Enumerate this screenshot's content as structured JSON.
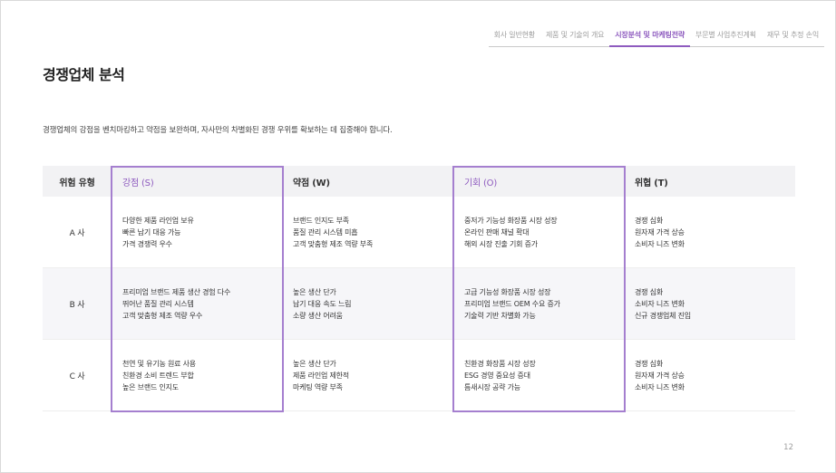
{
  "nav": {
    "tabs": [
      {
        "label": "회사 일반현황",
        "active": false
      },
      {
        "label": "제품 및 기술의 개요",
        "active": false
      },
      {
        "label": "시장분석 및 마케팅전략",
        "active": true
      },
      {
        "label": "부문별 사업추진계획",
        "active": false
      },
      {
        "label": "재무 및 추정 손익",
        "active": false
      }
    ],
    "accent_color": "#8e5bbf"
  },
  "page": {
    "title": "경쟁업체 분석",
    "description": "경쟁업체의 강점을 벤치마킹하고 약점을 보완하며, 자사만의 차별화된 경쟁 우위를 확보하는 데 집중해야 합니다.",
    "page_number": "12"
  },
  "table": {
    "headers": [
      "위험 유형",
      "강점 (S)",
      "약점 (W)",
      "기회 (O)",
      "위협 (T)"
    ],
    "rows": [
      {
        "label": "A 사",
        "strength": [
          "다양한 제품 라인업 보유",
          "빠른 납기 대응 가능",
          "가격 경쟁력 우수"
        ],
        "weakness": [
          "브랜드 인지도 부족",
          "품질 관리 시스템 미흡",
          "고객 맞춤형 제조 역량 부족"
        ],
        "opportunity": [
          "중저가 기능성 화장품 시장 성장",
          "온라인 판매 채널 확대",
          "해외 시장 진출 기회 증가"
        ],
        "threat": [
          "경쟁 심화",
          "원자재 가격 상승",
          "소비자 니즈 변화"
        ]
      },
      {
        "label": "B 사",
        "strength": [
          "프리미엄 브랜드 제품 생산 경험 다수",
          "뛰어난 품질 관리 시스템",
          "고객 맞춤형 제조 역량 우수"
        ],
        "weakness": [
          "높은 생산 단가",
          "납기 대응 속도 느림",
          "소량 생산 어려움"
        ],
        "opportunity": [
          "고급 기능성 화장품 시장 성장",
          "프리미엄 브랜드 OEM 수요 증가",
          "기술력 기반 차별화 가능"
        ],
        "threat": [
          "경쟁 심화",
          "소비자 니즈 변화",
          "신규 경쟁업체 진입"
        ]
      },
      {
        "label": "C 사",
        "strength": [
          "천연 및 유기농 원료 사용",
          "친환경 소비 트렌드 부합",
          "높은 브랜드 인지도"
        ],
        "weakness": [
          "높은 생산 단가",
          "제품 라인업 제한적",
          "마케팅 역량 부족"
        ],
        "opportunity": [
          "친환경 화장품 시장 성장",
          "ESG 경영 중요성 증대",
          "틈새시장 공략 가능"
        ],
        "threat": [
          "경쟁 심화",
          "원자재 가격 상승",
          "소비자 니즈 변화"
        ]
      }
    ]
  }
}
